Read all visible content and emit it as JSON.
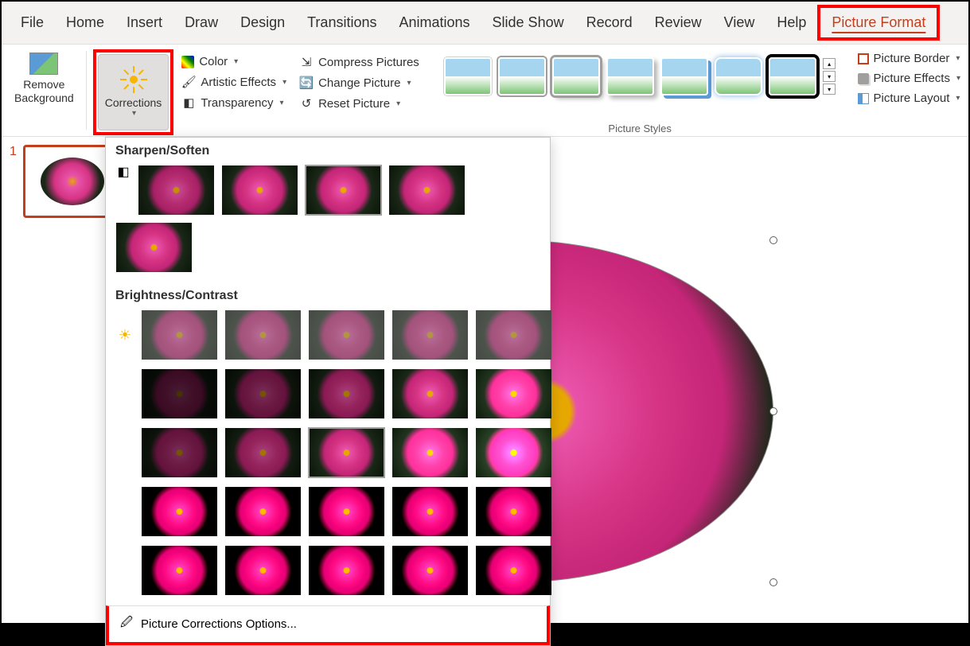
{
  "tabs": {
    "file": "File",
    "home": "Home",
    "insert": "Insert",
    "draw": "Draw",
    "design": "Design",
    "transitions": "Transitions",
    "animations": "Animations",
    "slideshow": "Slide Show",
    "record": "Record",
    "review": "Review",
    "view": "View",
    "help": "Help",
    "picture_format": "Picture Format"
  },
  "ribbon": {
    "remove_bg": "Remove\nBackground",
    "corrections": "Corrections",
    "color": "Color",
    "artistic": "Artistic Effects",
    "transparency": "Transparency",
    "compress": "Compress Pictures",
    "change": "Change Picture",
    "reset": "Reset Picture",
    "styles_label": "Picture Styles",
    "border": "Picture Border",
    "effects": "Picture Effects",
    "layout": "Picture Layout"
  },
  "dropdown": {
    "sharpen_title": "Sharpen/Soften",
    "brightness_title": "Brightness/Contrast",
    "footer_label": "Picture Corrections Options..."
  },
  "slide": {
    "number": "1"
  }
}
